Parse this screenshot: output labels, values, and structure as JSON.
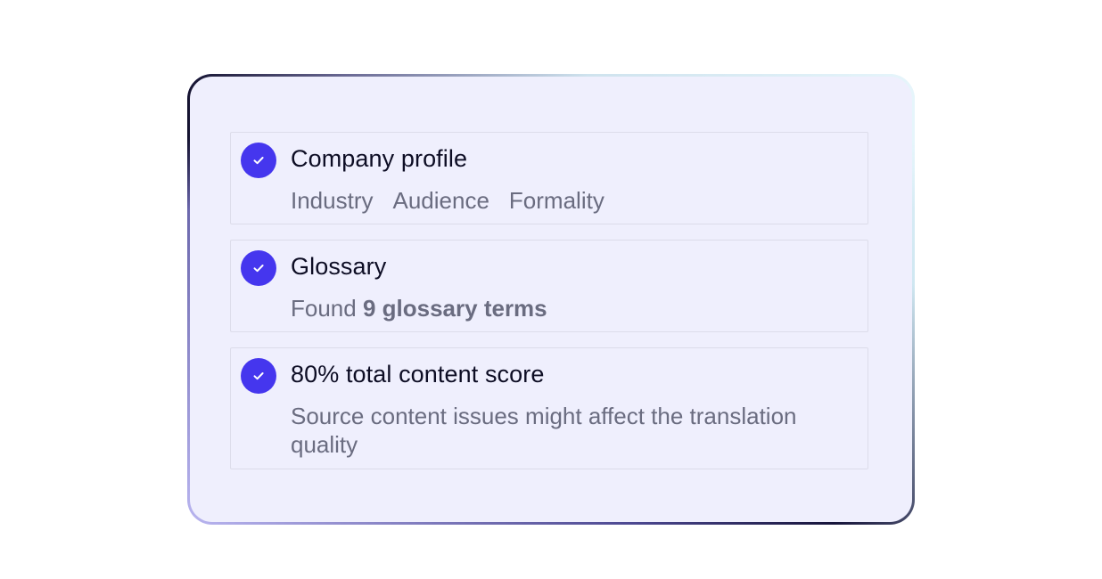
{
  "steps": [
    {
      "title": "Company profile",
      "tags": [
        "Industry",
        "Audience",
        "Formality"
      ]
    },
    {
      "title": "Glossary",
      "detail_prefix": "Found",
      "detail_strong": "9 glossary terms"
    },
    {
      "title": "80% total content score",
      "detail": "Source content issues might affect the translation quality"
    }
  ],
  "colors": {
    "check_fill": "#4536ee",
    "card_background": "#efeffd",
    "title_text": "#0d0d24",
    "muted_text": "#6a6c80"
  },
  "icons": {
    "status": "check-circle-icon"
  }
}
